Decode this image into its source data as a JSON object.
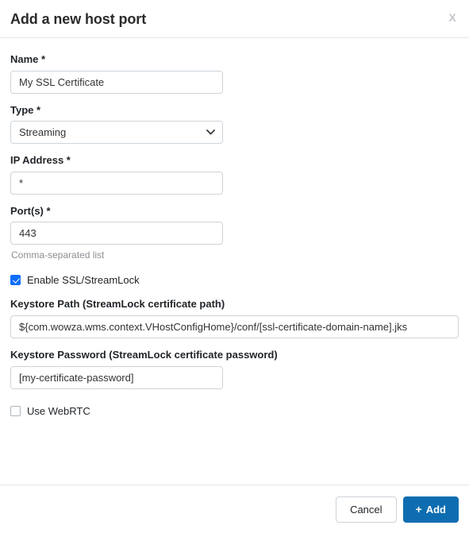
{
  "dialog": {
    "title": "Add a new host port",
    "close_label": "X",
    "close_icon": "close-x-icon"
  },
  "form": {
    "name": {
      "label": "Name *",
      "value": "My SSL Certificate",
      "placeholder": ""
    },
    "type": {
      "label": "Type *",
      "value": "Streaming",
      "options": [
        "Streaming"
      ],
      "arrow_icon": "chevron-down-icon"
    },
    "ip_address": {
      "label": "IP Address *",
      "value": "*",
      "placeholder": ""
    },
    "ports": {
      "label": "Port(s) *",
      "value": "443",
      "placeholder": "",
      "help": "Comma-separated list"
    },
    "enable_ssl": {
      "label": "Enable SSL/StreamLock",
      "checked": true
    },
    "keystore_path": {
      "label": "Keystore Path (StreamLock certificate path)",
      "value": "${com.wowza.wms.context.VHostConfigHome}/conf/[ssl-certificate-domain-name].jks",
      "placeholder": ""
    },
    "keystore_password": {
      "label": "Keystore Password (StreamLock certificate password)",
      "value": "[my-certificate-password]",
      "placeholder": ""
    },
    "use_webrtc": {
      "label": "Use WebRTC",
      "checked": false
    }
  },
  "footer": {
    "cancel_label": "Cancel",
    "add_label": "Add",
    "add_plus_glyph": "+"
  },
  "colors": {
    "primary_button": "#0e6db0",
    "checkbox_checked": "#0d6efd",
    "border": "#ced4da",
    "divider": "#e6e6e6",
    "help_text": "#8b8f94"
  }
}
